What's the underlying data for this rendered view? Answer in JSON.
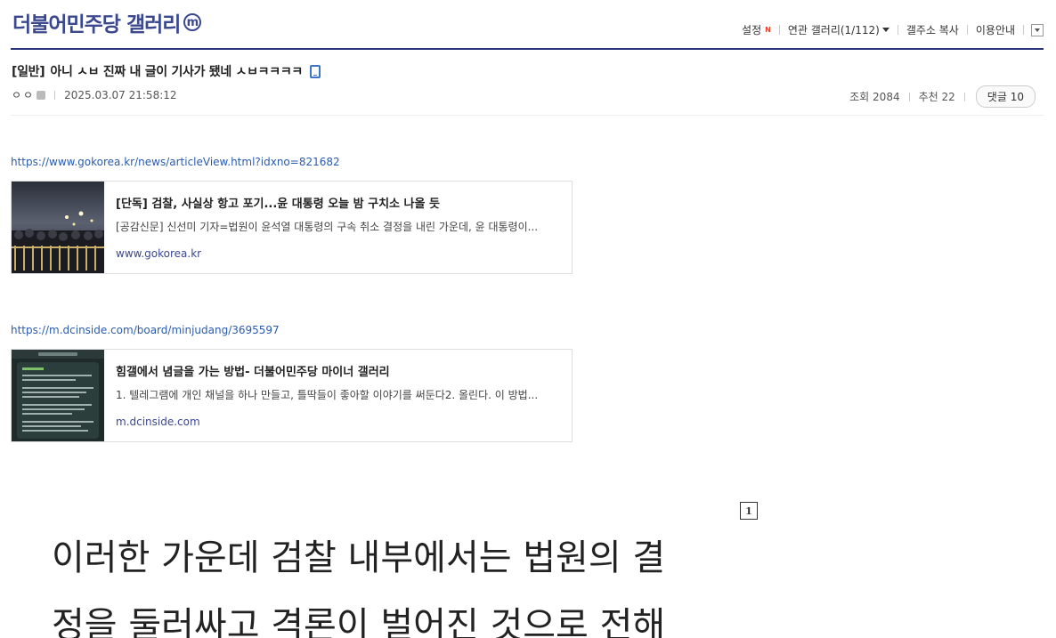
{
  "gallery": {
    "title": "더불어민주당 갤러리",
    "badge": "ⓜ"
  },
  "topmenu": {
    "settings": "설정",
    "new_badge": "N",
    "related": "연관 갤러리(1/112)",
    "copy_addr": "갤주소 복사",
    "guide": "이용안내"
  },
  "post": {
    "head": "[일반]",
    "title": "아니 ㅅㅂ 진짜 내 글이 기사가 됐네 ㅅㅂㅋㅋㅋㅋ",
    "writer": "ㅇㅇ",
    "date": "2025.03.07 21:58:12",
    "views_label": "조회",
    "views": "2084",
    "recommend_label": "추천",
    "recommend": "22",
    "comments_label": "댓글",
    "comments": "10"
  },
  "links": [
    {
      "url": "https://www.gokorea.kr/news/articleView.html?idxno=821682",
      "title": "[단독] 검찰, 사실상 항고 포기...윤 대통령 오늘 밤 구치소 나올 듯",
      "desc": "[공감신문] 신선미 기자=법원이 윤석열 대통령의 구속 취소 결정을 내린 가운데, 윤 대통령이...",
      "domain": "www.gokorea.kr"
    },
    {
      "url": "https://m.dcinside.com/board/minjudang/3695597",
      "title": "힘갤에서 념글을 가는 방법- 더불어민주당 마이너 갤러리",
      "desc": "1. 텔레그램에 개인 채널을 하나 만들고, 틀딱들이 좋아할 이야기를 써둔다2. 올린다. 이 방법...",
      "domain": "m.dcinside.com"
    }
  ],
  "image": {
    "number": "1",
    "line1": "이러한 가운데 검찰 내부에서는 법원의 결",
    "line2": "정을 둘러싸고 격론이 벌어진 것으로 전해"
  },
  "colors": {
    "brand": "#3b4890",
    "link": "#2a5cb0",
    "new": "#e4442b",
    "phone": "#3b74c8"
  }
}
